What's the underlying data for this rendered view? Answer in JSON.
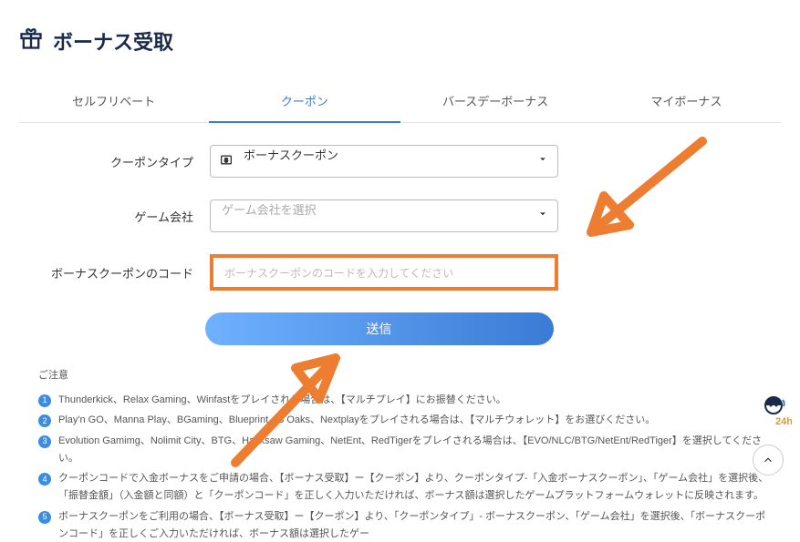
{
  "header": {
    "title": "ボーナス受取"
  },
  "tabs": {
    "items": [
      {
        "label": "セルフリベート"
      },
      {
        "label": "クーポン"
      },
      {
        "label": "バースデーボーナス"
      },
      {
        "label": "マイボーナス"
      }
    ]
  },
  "form": {
    "coupon_type": {
      "label": "クーポンタイプ",
      "value": "ボーナスクーポン"
    },
    "company": {
      "label": "ゲーム会社",
      "placeholder": "ゲーム会社を選択"
    },
    "code": {
      "label": "ボーナスクーポンのコード",
      "placeholder": "ボーナスクーポンのコードを入力してください"
    },
    "submit": "送信"
  },
  "notes": {
    "title": "ご注意",
    "items": [
      "Thunderkick、Relax Gaming、Winfastをプレイされる場合は、【マルチプレイ】にお振替ください。",
      "Play'n GO、Manna Play、BGaming、Blueprint、3 Oaks、Nextplayをプレイされる場合は、【マルチウォレット】をお選びください。",
      "Evolution Gamimg、Nolimit City、BTG、Hacksaw Gaming、NetEnt、RedTigerをプレイされる場合は、【EVO/NLC/BTG/NetEnt/RedTiger】を選択してください。",
      "クーポンコードで入金ボーナスをご申請の場合、【ボーナス受取】ー【クーポン】より、クーポンタイプ-「入金ボーナスクーポン」、「ゲーム会社」を選択後、「振替金額」（入金額と同額）と「クーポンコード」を正しく入力いただければ、ボーナス額は選択したゲームプラットフォームウォレットに反映されます。",
      "ボーナスクーポンをご利用の場合、【ボーナス受取】ー【クーポン】より、「クーポンタイプ」- ボーナスクーポン、「ゲーム会社」を選択後、「ボーナスクーポンコード」を正しくご入力いただければ、ボーナス額は選択したゲー"
    ]
  },
  "support_badge": "24h",
  "colors": {
    "accent": "#3a7bd5",
    "annotation": "#ed7d31"
  }
}
